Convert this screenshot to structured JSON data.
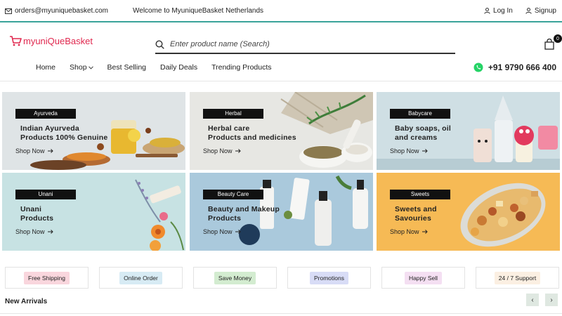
{
  "topbar": {
    "email": "orders@myuniquebasket.com",
    "welcome": "Welcome to MyuniqueBasket Netherlands",
    "login": "Log In",
    "signup": "Signup"
  },
  "header": {
    "logo_text": "myuniQueBasket",
    "search_placeholder": "Enter product name (Search)",
    "cart_count": "0",
    "phone": "+91 9790 666 400"
  },
  "nav": {
    "items": [
      {
        "label": "Home"
      },
      {
        "label": "Shop"
      },
      {
        "label": "Best Selling"
      },
      {
        "label": "Daily Deals"
      },
      {
        "label": "Trending Products"
      }
    ]
  },
  "categories": [
    {
      "tag": "Ayurveda",
      "headline": "Indian Ayurveda\nProducts 100% Genuine",
      "cta": "Shop Now",
      "bg": "#dfe4e6"
    },
    {
      "tag": "Herbal",
      "headline": "Herbal care\nProducts and medicines",
      "cta": "Shop Now",
      "bg": "#e7e7e3"
    },
    {
      "tag": "Babycare",
      "headline": "Baby soaps, oil\nand creams",
      "cta": "Shop Now",
      "bg": "#cfdfe4"
    },
    {
      "tag": "Unani",
      "headline": "Unani\nProducts",
      "cta": "Shop Now",
      "bg": "#c7e2e3"
    },
    {
      "tag": "Beauty Care",
      "headline": "Beauty and Makeup\nProducts",
      "cta": "Shop Now",
      "bg": "#aac9dc"
    },
    {
      "tag": "Sweets",
      "headline": "Sweets and\nSavouries",
      "cta": "Shop Now",
      "bg": "#f6ba55"
    }
  ],
  "features": [
    {
      "label": "Free Shipping",
      "color": "#f9d6dd"
    },
    {
      "label": "Online Order",
      "color": "#d7ebf4"
    },
    {
      "label": "Save Money",
      "color": "#d3ecd0"
    },
    {
      "label": "Promotions",
      "color": "#d8dcf6"
    },
    {
      "label": "Happy Sell",
      "color": "#f4dff2"
    },
    {
      "label": "24 / 7 Support",
      "color": "#fbefe2"
    }
  ],
  "section": {
    "new_arrivals": "New Arrivals",
    "prev": "‹",
    "next": "›"
  },
  "colors": {
    "accent": "#3aa39a",
    "brand": "#e0284f",
    "whatsapp": "#25d366"
  }
}
